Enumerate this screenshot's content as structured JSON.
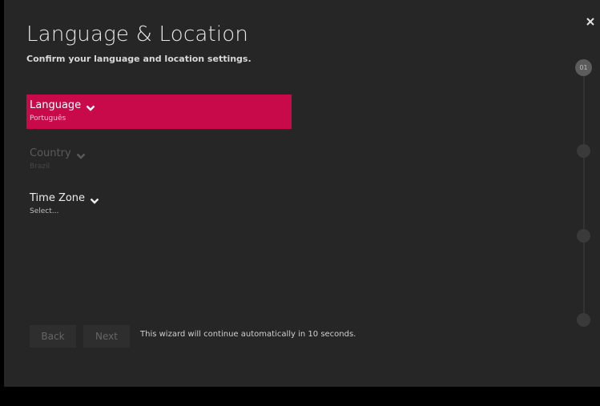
{
  "header": {
    "title": "Language & Location",
    "subtitle": "Confirm your language and location settings."
  },
  "options": [
    {
      "label": "Language",
      "value": "Português",
      "state": "selected"
    },
    {
      "label": "Country",
      "value": "Brazil",
      "state": "disabled"
    },
    {
      "label": "Time Zone",
      "value": "Select...",
      "state": "normal"
    }
  ],
  "footer": {
    "back_label": "Back",
    "next_label": "Next",
    "message": "This wizard will continue automatically in 10 seconds."
  },
  "stepper": {
    "current_step": "01",
    "total_steps": 4
  },
  "colors": {
    "accent": "#c8094a",
    "panel": "#262626",
    "background": "#000000"
  },
  "icons": {
    "close": "close-icon",
    "chevron": "chevron-down-icon"
  }
}
